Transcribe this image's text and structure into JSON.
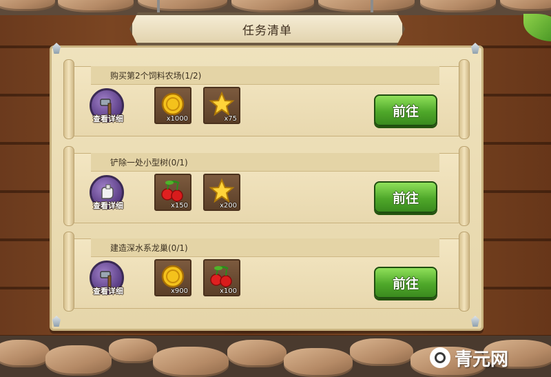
{
  "title": "任务清单",
  "watermark": "青元网",
  "tasks": [
    {
      "title": "购买第2个饲料农场(1/2)",
      "detail_label": "查看详细",
      "detail_icon": "hammer-icon",
      "rewards": [
        {
          "icon": "gold-coin-icon",
          "qty": "x1000"
        },
        {
          "icon": "star-icon",
          "qty": "x75"
        }
      ],
      "go_label": "前往"
    },
    {
      "title": "铲除一处小型树(0/1)",
      "detail_label": "查看详细",
      "detail_icon": "glove-icon",
      "rewards": [
        {
          "icon": "cherry-icon",
          "qty": "x150"
        },
        {
          "icon": "star-icon",
          "qty": "x200"
        }
      ],
      "go_label": "前往"
    },
    {
      "title": "建造深水系龙巢(0/1)",
      "detail_label": "查看详细",
      "detail_icon": "hammer-icon",
      "rewards": [
        {
          "icon": "gold-coin-icon",
          "qty": "x900"
        },
        {
          "icon": "cherry-icon",
          "qty": "x100"
        }
      ],
      "go_label": "前往"
    }
  ]
}
